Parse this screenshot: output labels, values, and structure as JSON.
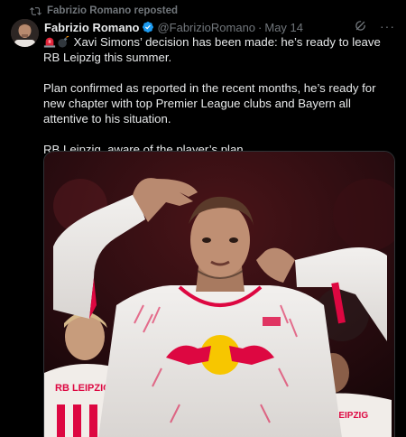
{
  "repost": {
    "text": "Fabrizio Romano reposted",
    "icon": "repost-icon"
  },
  "tweet": {
    "author_name": "Fabrizio Romano",
    "handle": "@FabrizioRomano",
    "separator": "·",
    "timestamp": "May 14",
    "verified": true,
    "paragraphs": [
      "Xavi Simons’ decision has been made: he’s ready to leave RB Leipzig this summer.",
      "Plan confirmed as reported in the recent months, he’s ready for new chapter with top Premier League clubs and Bayern all attentive to his situation.",
      "RB Leipzig, aware of the player’s plan."
    ],
    "emojis": [
      "siren-emoji",
      "bomb-emoji"
    ],
    "more_label": "···"
  },
  "media": {
    "jersey_text_left": "RB LEIPZIG",
    "jersey_text_right": "RB LEIPZIG"
  },
  "colors": {
    "background": "#000000",
    "muted": "#71767b",
    "text": "#e7e9ea",
    "verified_blue": "#1d9bf0",
    "leipzig_red": "#dd0741",
    "leipzig_yellow": "#f7c600"
  }
}
